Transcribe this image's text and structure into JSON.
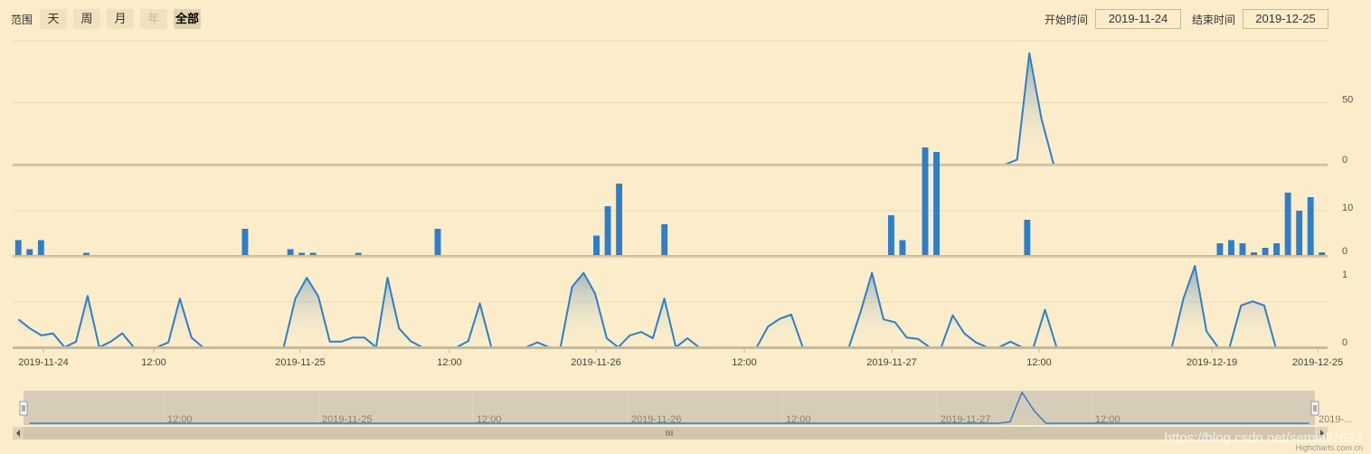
{
  "range_selector": {
    "label": "范围",
    "buttons": [
      {
        "label": "天",
        "state": "normal"
      },
      {
        "label": "周",
        "state": "normal"
      },
      {
        "label": "月",
        "state": "normal"
      },
      {
        "label": "年",
        "state": "disabled"
      },
      {
        "label": "全部",
        "state": "active"
      }
    ]
  },
  "date_inputs": {
    "start_label": "开始时间",
    "start_value": "2019-11-24",
    "end_label": "结束时间",
    "end_value": "2019-12-25"
  },
  "colors": {
    "background": "#fbedca",
    "series": "#2f7ec7",
    "gridline": "#e9dbb6",
    "axis": "#c7b99a",
    "navigator_mask": "#cfc6b5"
  },
  "chart_data": [
    {
      "type": "area",
      "panel": "top",
      "y_ticks": [
        0,
        50
      ],
      "ylim": [
        0,
        100
      ],
      "values": [
        0,
        0,
        0,
        0,
        0,
        0,
        0,
        0,
        0,
        0,
        0,
        0,
        0,
        0,
        0,
        0,
        0,
        0,
        0,
        0,
        0,
        0,
        0,
        0,
        0,
        0,
        0,
        0,
        0,
        0,
        0,
        0,
        0,
        0,
        0,
        0,
        0,
        0,
        0,
        0,
        0,
        0,
        0,
        0,
        0,
        0,
        0,
        0,
        0,
        0,
        0,
        0,
        0,
        0,
        0,
        0,
        0,
        0,
        0,
        0,
        0,
        0,
        0,
        0,
        0,
        0,
        0,
        0,
        0,
        0,
        0,
        0,
        0,
        0,
        0,
        0,
        0,
        0,
        0,
        0,
        0,
        0,
        4,
        90,
        37,
        0,
        0,
        0,
        0,
        0,
        0,
        0,
        0,
        0,
        0,
        0,
        0,
        0,
        0,
        0,
        0,
        0,
        0,
        0,
        0,
        0,
        0,
        0
      ]
    },
    {
      "type": "bar",
      "panel": "middle",
      "y_ticks": [
        0,
        10
      ],
      "ylim": [
        0,
        20
      ],
      "values": [
        3.5,
        1.5,
        3.5,
        0,
        0,
        0,
        0.7,
        0,
        0,
        0,
        0,
        0,
        0,
        0,
        0,
        0,
        0,
        0,
        0,
        0,
        6,
        0,
        0,
        0,
        1.5,
        0.7,
        0.7,
        0,
        0,
        0,
        0.7,
        0,
        0,
        0,
        0,
        0,
        0,
        6,
        0,
        0,
        0,
        0,
        0,
        0,
        0,
        0,
        0,
        0,
        0,
        0,
        0,
        4.5,
        11,
        16,
        0,
        0,
        0,
        7,
        0,
        0,
        0,
        0,
        0,
        0,
        0,
        0,
        0,
        0,
        0,
        0,
        0,
        0,
        0,
        0,
        0,
        0,
        0,
        9,
        3.5,
        0,
        24,
        23,
        0,
        0,
        0,
        0,
        0,
        0,
        0,
        8,
        0,
        0,
        0,
        0,
        0,
        0,
        0,
        0,
        0,
        0,
        0,
        0,
        0,
        0,
        0,
        0,
        2.8,
        3.5,
        2.8,
        0.8,
        1.8,
        2.8,
        14,
        10,
        13,
        0.8
      ]
    },
    {
      "type": "area",
      "panel": "bottom",
      "y_ticks": [
        0,
        1
      ],
      "ylim": [
        0,
        1.3
      ],
      "values": [
        0.4,
        0.27,
        0.17,
        0.2,
        0,
        0.08,
        0.74,
        0,
        0.08,
        0.2,
        0,
        0,
        0,
        0.07,
        0.7,
        0.14,
        0,
        0,
        0,
        0,
        0,
        0,
        0,
        0,
        0.7,
        1,
        0.73,
        0.08,
        0.08,
        0.14,
        0.14,
        0,
        1,
        0.27,
        0.09,
        0,
        0,
        0,
        0,
        0.09,
        0.63,
        0,
        0,
        0,
        0,
        0.07,
        0,
        0,
        0.87,
        1.07,
        0.77,
        0.13,
        0,
        0.17,
        0.22,
        0.13,
        0.7,
        0,
        0.13,
        0,
        0,
        0,
        0,
        0,
        0,
        0.3,
        0.41,
        0.47,
        0,
        0,
        0,
        0,
        0,
        0.5,
        1.07,
        0.4,
        0.36,
        0.14,
        0.12,
        0,
        0,
        0.46,
        0.2,
        0.07,
        0,
        0,
        0.08,
        0,
        0,
        0.54,
        0,
        0,
        0,
        0,
        0,
        0,
        0,
        0,
        0,
        0,
        0,
        0.7,
        1.17,
        0.23,
        0,
        0,
        0.6,
        0.66,
        0.6,
        0,
        0,
        0,
        0,
        0
      ]
    }
  ],
  "x_axis": {
    "tick_labels": [
      "2019-11-24",
      "12:00",
      "2019-11-25",
      "12:00",
      "2019-11-26",
      "12:00",
      "2019-11-27",
      "12:00",
      "2019-12-19",
      "2019-12-25"
    ]
  },
  "navigator": {
    "tick_labels": [
      "12:00",
      "2019-11-25",
      "12:00",
      "2019-11-26",
      "12:00",
      "2019-11-27",
      "12:00",
      "2019-..."
    ],
    "left_handle_icon": "grip-icon",
    "right_handle_icon": "grip-icon",
    "scroll_left_icon": "arrow-left-icon",
    "scroll_right_icon": "arrow-right-icon",
    "scroll_grip_icon": "grip-icon"
  },
  "credit": "Highcharts.com.cn",
  "watermark": "https://blog.csdn.net/semiall7633"
}
